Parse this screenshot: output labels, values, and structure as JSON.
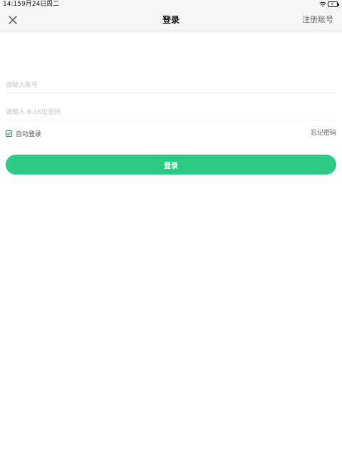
{
  "status_bar": {
    "time": "14:15",
    "date": "9月24日周二"
  },
  "nav": {
    "close_icon": "close-icon",
    "title": "登录",
    "register_label": "注册账号"
  },
  "form": {
    "account_placeholder": "请输入账号",
    "account_value": "",
    "password_placeholder": "请输入 6-16位密码",
    "password_value": "",
    "auto_login_label": "自动登录",
    "auto_login_checked": true,
    "forgot_label": "忘记密码",
    "login_label": "登录"
  },
  "colors": {
    "accent": "#2ec985",
    "checkbox": "#2e8b57"
  }
}
